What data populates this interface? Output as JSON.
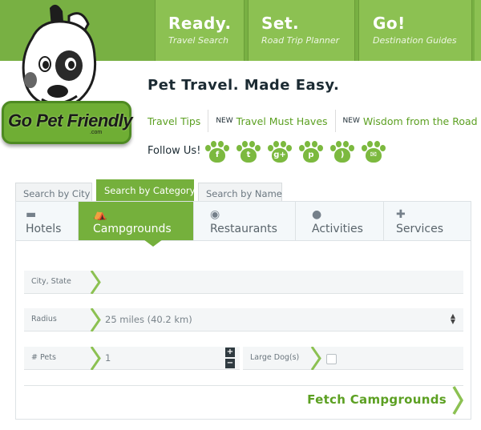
{
  "nav": [
    {
      "title": "Ready.",
      "subtitle": "Travel Search"
    },
    {
      "title": "Set.",
      "subtitle": "Road Trip Planner"
    },
    {
      "title": "Go!",
      "subtitle": "Destination Guides"
    }
  ],
  "logo": {
    "text": "Go Pet Friendly",
    "suffix": ".com"
  },
  "tagline": "Pet Travel. Made Easy.",
  "links": [
    {
      "badge": "",
      "label": "Travel Tips"
    },
    {
      "badge": "NEW",
      "label": "Travel Must Haves"
    },
    {
      "badge": "NEW",
      "label": "Wisdom from the Road"
    }
  ],
  "follow": {
    "label": "Follow Us!",
    "icons": [
      "facebook-paw-icon",
      "twitter-paw-icon",
      "google-plus-paw-icon",
      "pinterest-paw-icon",
      "rss-paw-icon",
      "email-paw-icon"
    ],
    "glyphs": [
      "f",
      "t",
      "g+",
      "p",
      ")",
      "✉"
    ]
  },
  "search_tabs": [
    "Search by City",
    "Search by Category",
    "Search by Name"
  ],
  "search_tabs_active": 1,
  "categories": [
    {
      "label": "Hotels",
      "icon": "bed-icon",
      "glyph": "▬"
    },
    {
      "label": "Campgrounds",
      "icon": "tent-icon",
      "glyph": "⛺"
    },
    {
      "label": "Restaurants",
      "icon": "plate-icon",
      "glyph": "◉"
    },
    {
      "label": "Activities",
      "icon": "ball-icon",
      "glyph": "●"
    },
    {
      "label": "Services",
      "icon": "plus-icon",
      "glyph": "✚"
    }
  ],
  "categories_active": 1,
  "form": {
    "location": {
      "label": "City, State",
      "placeholder": ""
    },
    "radius": {
      "label": "Radius",
      "value": "25 miles (40.2 km)"
    },
    "pets": {
      "label": "# Pets",
      "value": "1",
      "plus": "+",
      "minus": "−"
    },
    "large_dogs": {
      "label": "Large Dog(s)",
      "checked": false
    }
  },
  "fetch_button": "Fetch Campgrounds",
  "colors": {
    "brand_green": "#75b03c",
    "link_green": "#5ca022",
    "dark_text": "#1c2b33"
  }
}
